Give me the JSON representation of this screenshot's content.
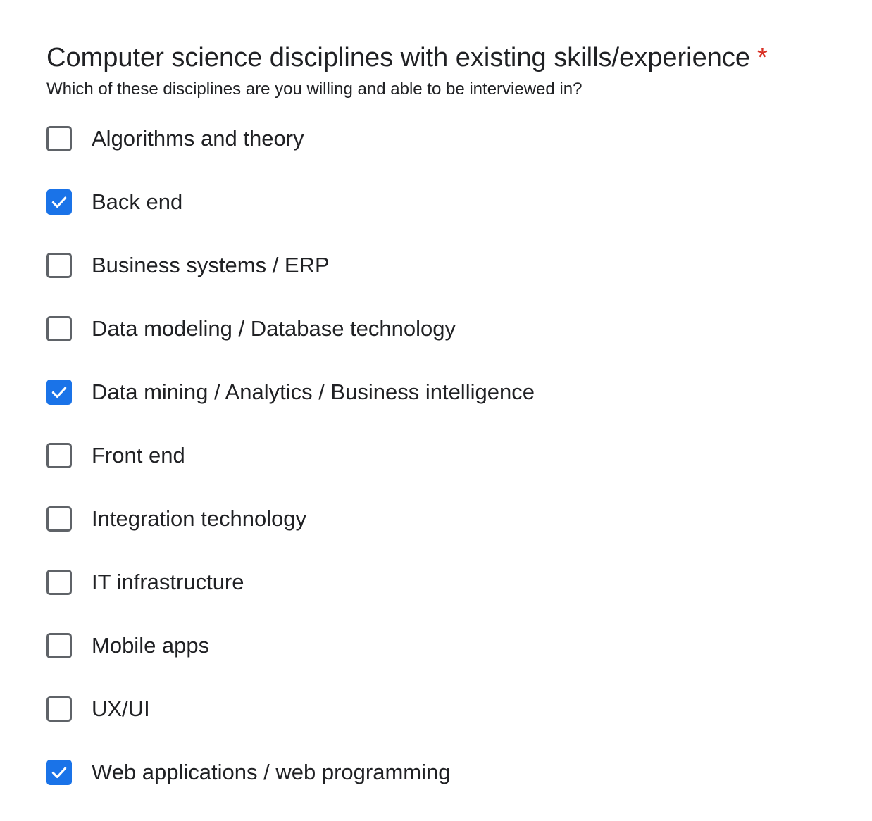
{
  "question": {
    "title": "Computer science disciplines with existing skills/experience",
    "required_marker": "*",
    "help_text": "Which of these disciplines are you willing and able to be interviewed in?",
    "options": [
      {
        "label": "Algorithms and theory",
        "checked": false
      },
      {
        "label": "Back end",
        "checked": true
      },
      {
        "label": "Business systems / ERP",
        "checked": false
      },
      {
        "label": "Data modeling / Database technology",
        "checked": false
      },
      {
        "label": "Data mining / Analytics / Business intelligence",
        "checked": true
      },
      {
        "label": "Front end",
        "checked": false
      },
      {
        "label": "Integration technology",
        "checked": false
      },
      {
        "label": "IT infrastructure",
        "checked": false
      },
      {
        "label": "Mobile apps",
        "checked": false
      },
      {
        "label": "UX/UI",
        "checked": false
      },
      {
        "label": "Web applications / web programming",
        "checked": true
      }
    ]
  },
  "colors": {
    "accent": "#1a73e8",
    "required": "#d93025",
    "text": "#202124",
    "checkbox_border": "#5f6368"
  },
  "icons": {
    "checked": "check-icon"
  }
}
